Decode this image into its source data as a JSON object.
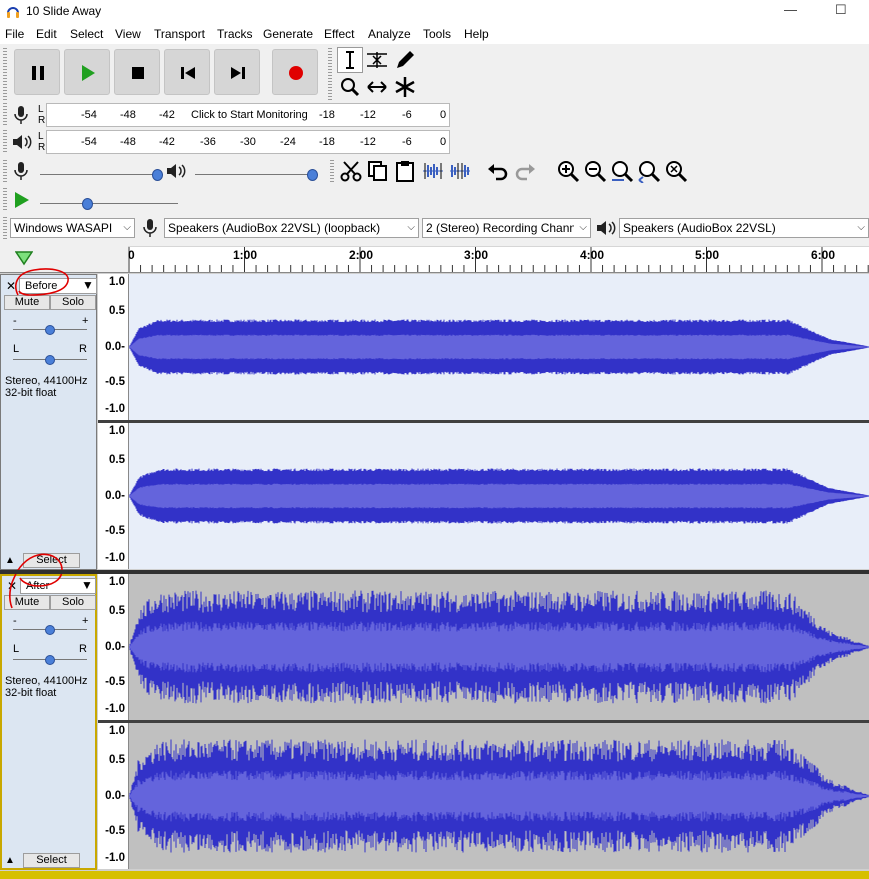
{
  "window": {
    "title": "10 Slide Away",
    "minimize": "—",
    "maximize": "☐",
    "close": "✕"
  },
  "menu": [
    "File",
    "Edit",
    "Select",
    "View",
    "Transport",
    "Tracks",
    "Generate",
    "Effect",
    "Analyze",
    "Tools",
    "Help"
  ],
  "meters": {
    "record": {
      "left_ch": "L",
      "right_ch": "R",
      "ticks": [
        "-54",
        "-48",
        "-42",
        "Click to Start Monitoring",
        "-18",
        "-12",
        "-6",
        "0"
      ]
    },
    "play": {
      "left_ch": "L",
      "right_ch": "R",
      "ticks": [
        "-54",
        "-48",
        "-42",
        "-36",
        "-30",
        "-24",
        "-18",
        "-12",
        "-6",
        "0"
      ]
    }
  },
  "device": {
    "host": "Windows WASAPI",
    "recording_device": "Speakers (AudioBox 22VSL) (loopback)",
    "channels": "2 (Stereo) Recording Chann",
    "playback_device": "Speakers (AudioBox 22VSL)"
  },
  "ruler": {
    "labels": [
      "0",
      "1:00",
      "2:00",
      "3:00",
      "4:00",
      "5:00",
      "6:00"
    ]
  },
  "tracks": [
    {
      "name": "Before",
      "mute": "Mute",
      "solo": "Solo",
      "gain_minus": "-",
      "gain_plus": "+",
      "pan_left": "L",
      "pan_right": "R",
      "info_line1": "Stereo, 44100Hz",
      "info_line2": "32-bit float",
      "select": "Select",
      "close": "✕",
      "scale": [
        "1.0",
        "0.5",
        "0.0-",
        "-0.5",
        "-1.0"
      ],
      "background": "#e8eef9",
      "amplitude": 0.45
    },
    {
      "name": "After",
      "mute": "Mute",
      "solo": "Solo",
      "gain_minus": "-",
      "gain_plus": "+",
      "pan_left": "L",
      "pan_right": "R",
      "info_line1": "Stereo, 44100Hz",
      "info_line2": "32-bit float",
      "select": "Select",
      "close": "✕",
      "scale": [
        "1.0",
        "0.5",
        "0.0-",
        "-0.5",
        "-1.0"
      ],
      "background": "#c0c0c0",
      "amplitude": 0.82
    }
  ],
  "colors": {
    "wave_outer": "#3232c8",
    "wave_inner": "#6464dc",
    "annotation": "#e00000",
    "record": "#e00000",
    "play": "#20a020"
  }
}
